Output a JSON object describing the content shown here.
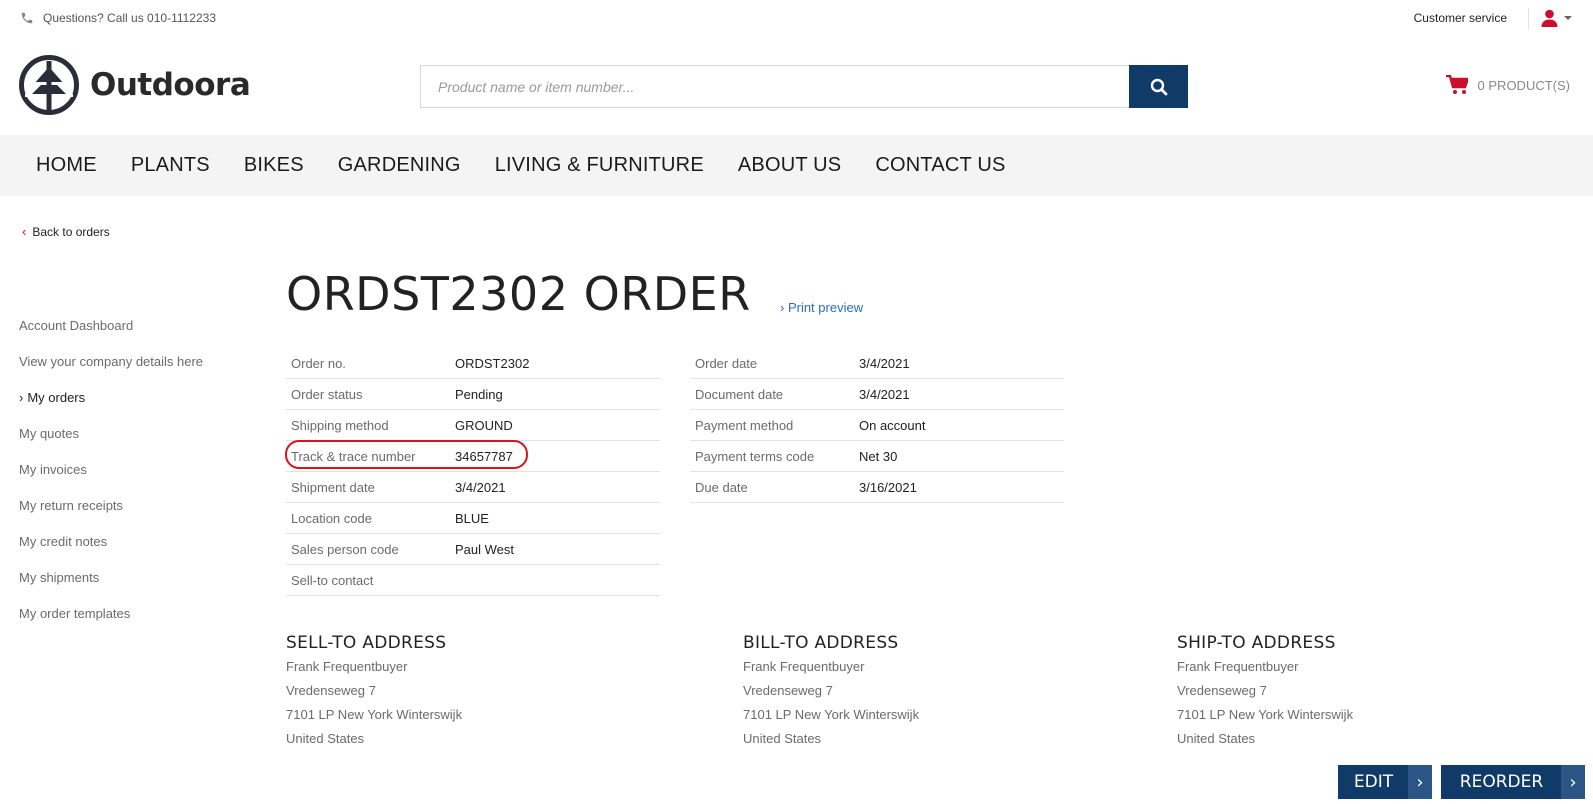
{
  "topbar": {
    "phone_text": "Questions? Call us 010-1112233",
    "customer_service": "Customer service"
  },
  "header": {
    "logo_text": "Outdoora",
    "search_placeholder": "Product name or item number...",
    "cart_text": "0 PRODUCT(S)"
  },
  "nav": [
    "HOME",
    "PLANTS",
    "BIKES",
    "GARDENING",
    "LIVING & FURNITURE",
    "ABOUT US",
    "CONTACT US"
  ],
  "back_label": "Back to orders",
  "sidebar": {
    "items": [
      "Account Dashboard",
      "View your company details here",
      "My orders",
      "My quotes",
      "My invoices",
      "My return receipts",
      "My credit notes",
      "My shipments",
      "My order templates"
    ],
    "active": "My orders"
  },
  "order": {
    "title": "ORDST2302 ORDER",
    "print_preview": "› Print preview",
    "details_left": [
      {
        "label": "Order no.",
        "value": "ORDST2302"
      },
      {
        "label": "Order status",
        "value": "Pending"
      },
      {
        "label": "Shipping method",
        "value": "GROUND"
      },
      {
        "label": "Track & trace number",
        "value": "34657787"
      },
      {
        "label": "Shipment date",
        "value": "3/4/2021"
      },
      {
        "label": "Location code",
        "value": "BLUE"
      },
      {
        "label": "Sales person code",
        "value": "Paul West"
      },
      {
        "label": "Sell-to contact",
        "value": ""
      }
    ],
    "details_right": [
      {
        "label": "Order date",
        "value": "3/4/2021"
      },
      {
        "label": "Document date",
        "value": "3/4/2021"
      },
      {
        "label": "Payment method",
        "value": "On account"
      },
      {
        "label": "Payment terms code",
        "value": "Net 30"
      },
      {
        "label": "Due date",
        "value": "3/16/2021"
      }
    ]
  },
  "addresses": {
    "sell_to": {
      "heading": "SELL-TO ADDRESS",
      "lines": [
        "Frank Frequentbuyer",
        "Vredenseweg 7",
        "7101 LP New York Winterswijk",
        "United States"
      ]
    },
    "bill_to": {
      "heading": "BILL-TO ADDRESS",
      "lines": [
        "Frank Frequentbuyer",
        "Vredenseweg 7",
        "7101 LP New York Winterswijk",
        "United States"
      ]
    },
    "ship_to": {
      "heading": "SHIP-TO ADDRESS",
      "lines": [
        "Frank Frequentbuyer",
        "Vredenseweg 7",
        "7101 LP New York Winterswijk",
        "United States"
      ]
    }
  },
  "buttons": {
    "edit": "EDIT",
    "reorder": "REORDER"
  },
  "colors": {
    "brand_navy": "#103a67",
    "accent_red": "#c8102e",
    "link_blue": "#2a6ebd",
    "nav_bg": "#f4f4f4"
  },
  "icons": {
    "phone": "phone-icon",
    "user": "user-icon",
    "search": "search-icon",
    "cart": "cart-icon",
    "logo": "tree-logo-icon"
  }
}
